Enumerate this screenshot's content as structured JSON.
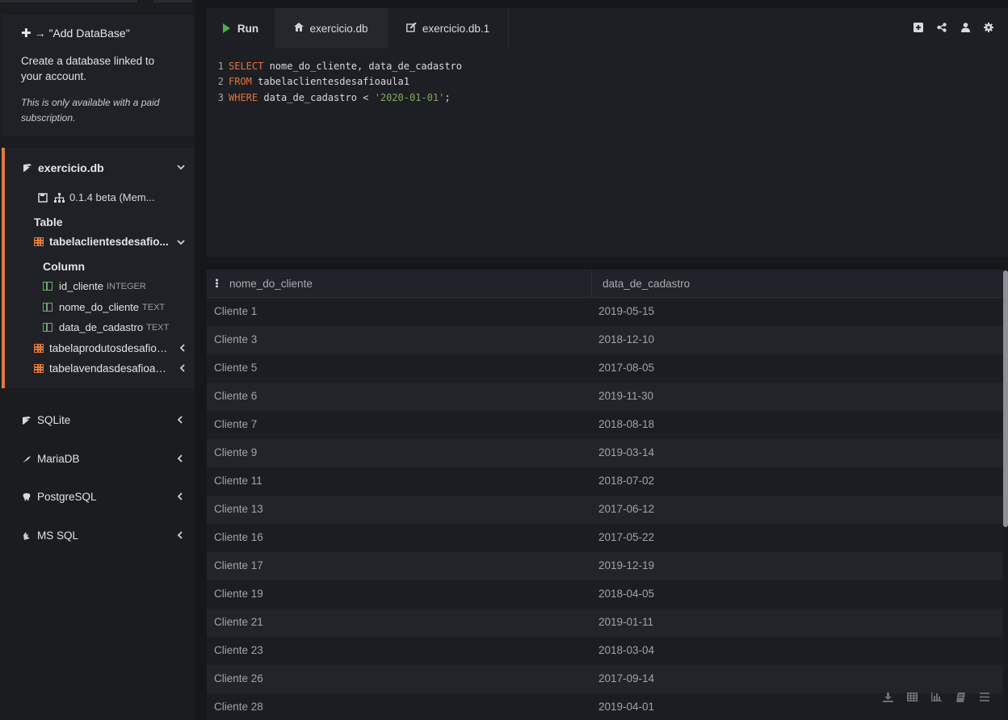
{
  "sidebar": {
    "add_db": {
      "title": "→ \"Add DataBase\"",
      "description": "Create a database linked to your account.",
      "note": "This is only available with a paid subscription."
    },
    "database": {
      "name": "exercicio.db",
      "version": "0.1.4 beta (Mem...",
      "table_heading": "Table",
      "column_heading": "Column",
      "tables": [
        {
          "name": "tabelaclientesdesafio...",
          "expanded": true,
          "columns": [
            {
              "name": "id_cliente",
              "type": "INTEGER"
            },
            {
              "name": "nome_do_cliente",
              "type": "TEXT"
            },
            {
              "name": "data_de_cadastro",
              "type": "TEXT"
            }
          ]
        },
        {
          "name": "tabelaprodutosdesafioa...",
          "expanded": false
        },
        {
          "name": "tabelavendasdesafioaul...",
          "expanded": false
        }
      ]
    },
    "engines": [
      {
        "name": "SQLite",
        "icon": "feather-icon"
      },
      {
        "name": "MariaDB",
        "icon": "seal-icon"
      },
      {
        "name": "PostgreSQL",
        "icon": "elephant-icon"
      },
      {
        "name": "MS SQL",
        "icon": "wrench-icon"
      }
    ]
  },
  "editor": {
    "run_label": "Run",
    "tabs": [
      {
        "label": "exercicio.db",
        "icon": "home-icon"
      },
      {
        "label": "exercicio.db.1",
        "icon": "edit-icon"
      }
    ],
    "toolbar_icons": [
      "add-box-icon",
      "share-icon",
      "user-icon",
      "gear-icon"
    ],
    "code": {
      "line_numbers": [
        "1",
        "2",
        "3"
      ],
      "l1_kw": "SELECT",
      "l1_rest": " nome_do_cliente, data_de_cadastro",
      "l2_kw": "FROM",
      "l2_rest": " tabelaclientesdesafioaula1",
      "l3_kw": "WHERE",
      "l3_mid": " data_de_cadastro < ",
      "l3_str": "'2020-01-01'",
      "l3_end": ";"
    }
  },
  "results": {
    "columns": [
      "nome_do_cliente",
      "data_de_cadastro"
    ],
    "rows": [
      [
        "Cliente 1",
        "2019-05-15"
      ],
      [
        "Cliente 3",
        "2018-12-10"
      ],
      [
        "Cliente 5",
        "2017-08-05"
      ],
      [
        "Cliente 6",
        "2019-11-30"
      ],
      [
        "Cliente 7",
        "2018-08-18"
      ],
      [
        "Cliente 9",
        "2019-03-14"
      ],
      [
        "Cliente 11",
        "2018-07-02"
      ],
      [
        "Cliente 13",
        "2017-06-12"
      ],
      [
        "Cliente 16",
        "2017-05-22"
      ],
      [
        "Cliente 17",
        "2019-12-19"
      ],
      [
        "Cliente 19",
        "2018-04-05"
      ],
      [
        "Cliente 21",
        "2019-01-11"
      ],
      [
        "Cliente 23",
        "2018-03-04"
      ],
      [
        "Cliente 26",
        "2017-09-14"
      ],
      [
        "Cliente 28",
        "2019-04-01"
      ]
    ],
    "bottom_icons": [
      "download-icon",
      "table-icon",
      "bar-chart-icon",
      "book-icon",
      "menu-icon"
    ]
  }
}
